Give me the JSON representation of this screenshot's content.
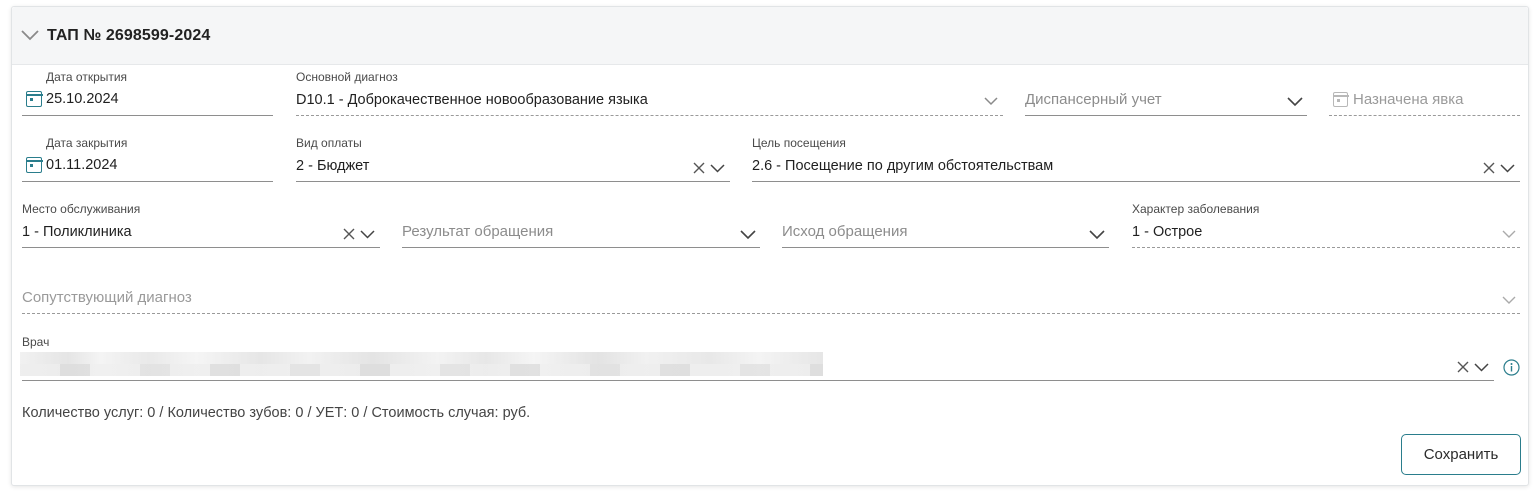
{
  "card": {
    "title": "ТАП № 2698599-2024"
  },
  "fields": {
    "open_date": {
      "label": "Дата открытия",
      "value": "25.10.2024"
    },
    "main_diagnosis": {
      "label": "Основной диагноз",
      "value": "D10.1 - Доброкачественное новообразование языка"
    },
    "dispensary": {
      "placeholder": "Диспансерный учет"
    },
    "appointment": {
      "label": "Назначена явка"
    },
    "close_date": {
      "label": "Дата закрытия",
      "value": "01.11.2024"
    },
    "payment_type": {
      "label": "Вид оплаты",
      "value": "2 - Бюджет"
    },
    "visit_purpose": {
      "label": "Цель посещения",
      "value": "2.6 - Посещение по другим обстоятельствам"
    },
    "service_place": {
      "label": "Место обслуживания",
      "value": "1 - Поликлиника"
    },
    "appeal_result": {
      "placeholder": "Результат обращения"
    },
    "appeal_outcome": {
      "placeholder": "Исход обращения"
    },
    "disease_character": {
      "label": "Характер заболевания",
      "value": "1 - Острое"
    },
    "concomitant_diagnosis": {
      "placeholder": "Сопутствующий диагноз"
    },
    "doctor": {
      "label": "Врач"
    }
  },
  "summary": "Количество услуг: 0 / Количество зубов: 0 / УЕТ: 0 / Стоимость случая: руб.",
  "buttons": {
    "save": "Сохранить"
  },
  "colors": {
    "accent": "#2a7d8c",
    "info": "#2a7d8c"
  }
}
